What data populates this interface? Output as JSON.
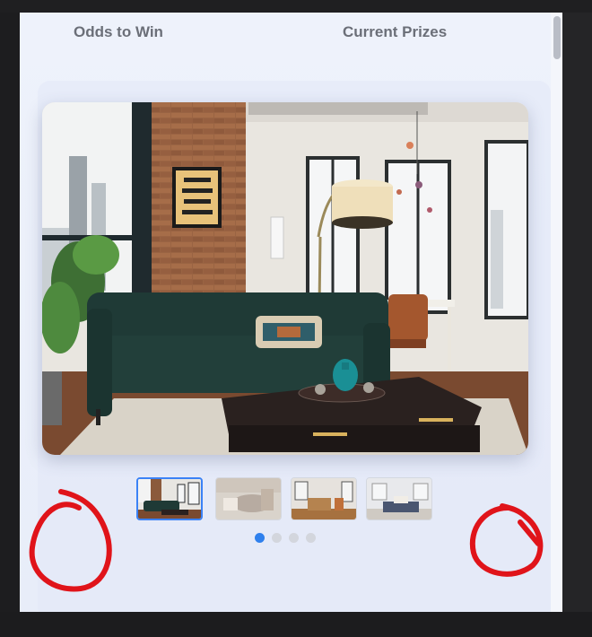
{
  "tabs": [
    {
      "label": "Odds to Win"
    },
    {
      "label": "Current Prizes"
    }
  ],
  "gallery": {
    "hero_alt": "Loft living room with dark green sofa, brick wall, floor lamp and large windows",
    "thumbnails": [
      {
        "name": "thumb-living-room",
        "active": true
      },
      {
        "name": "thumb-bedroom",
        "active": false
      },
      {
        "name": "thumb-open-kitchen",
        "active": false
      },
      {
        "name": "thumb-dining",
        "active": false
      }
    ],
    "dots": 4,
    "active_dot": 1
  },
  "annotations": {
    "color": "#e0141a"
  },
  "colors": {
    "accent": "#2f80ed",
    "panel_bg": "#eef2fb"
  }
}
